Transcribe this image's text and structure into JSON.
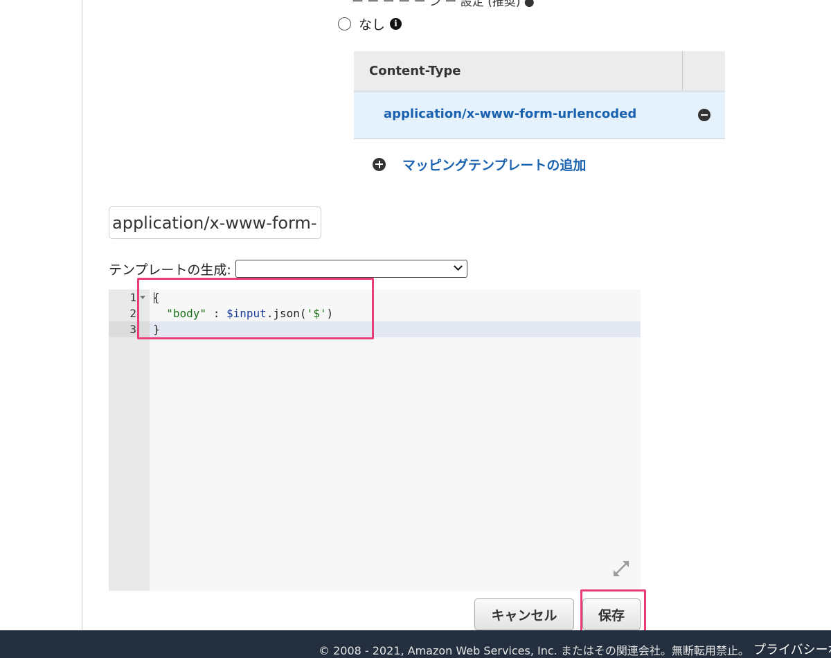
{
  "header_cut_text": "ー ー ー ー ー ン ー 設定 (推奨) ●",
  "passthrough": {
    "option_label": "なし",
    "info_icon": "info-icon"
  },
  "content_type_table": {
    "header": "Content-Type",
    "rows": [
      {
        "value": "application/x-www-form-urlencoded",
        "action_icon": "minus-circle-icon"
      }
    ],
    "add_label": "マッピングテンプレートの追加",
    "add_icon": "plus-circle-icon"
  },
  "content_type_input": {
    "value": "application/x-www-form-urlencoded"
  },
  "template_generator": {
    "label": "テンプレートの生成:",
    "selected": ""
  },
  "editor": {
    "line_numbers": [
      "1",
      "2",
      "3"
    ],
    "line1": "{",
    "line2": {
      "indent": "  ",
      "key": "\"body\"",
      "sep": " : ",
      "var": "$input",
      "rest": ".json(",
      "arg": "'$'",
      "close": ")"
    },
    "line3": "}",
    "active_line": 3,
    "resize_icon": "expand-icon"
  },
  "buttons": {
    "cancel": "キャンセル",
    "save": "保存"
  },
  "footer": {
    "copyright": "© 2008 - 2021, Amazon Web Services, Inc. またはその関連会社。無断転用禁止。",
    "privacy": "プライバシーポ"
  },
  "colors": {
    "link": "#1a62b0",
    "row_highlight": "#e5f1fb",
    "annotation": "#ea3c76",
    "footer_bg": "#232f3e"
  }
}
